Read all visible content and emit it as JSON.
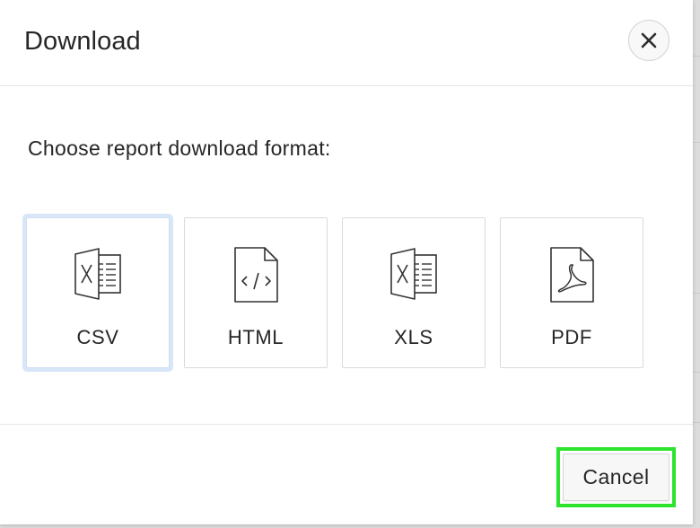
{
  "dialog": {
    "title": "Download",
    "prompt": "Choose report download format:",
    "close_icon": "close-icon",
    "formats": [
      {
        "label": "CSV",
        "icon": "csv-file-icon",
        "focused": true
      },
      {
        "label": "HTML",
        "icon": "html-file-icon",
        "focused": false
      },
      {
        "label": "XLS",
        "icon": "xls-file-icon",
        "focused": false
      },
      {
        "label": "PDF",
        "icon": "pdf-file-icon",
        "focused": false
      }
    ],
    "cancel_label": "Cancel"
  },
  "colors": {
    "text": "#262626",
    "focus_ring": "#d8e6f8",
    "highlight": "#2de32d",
    "border": "#dadada"
  }
}
